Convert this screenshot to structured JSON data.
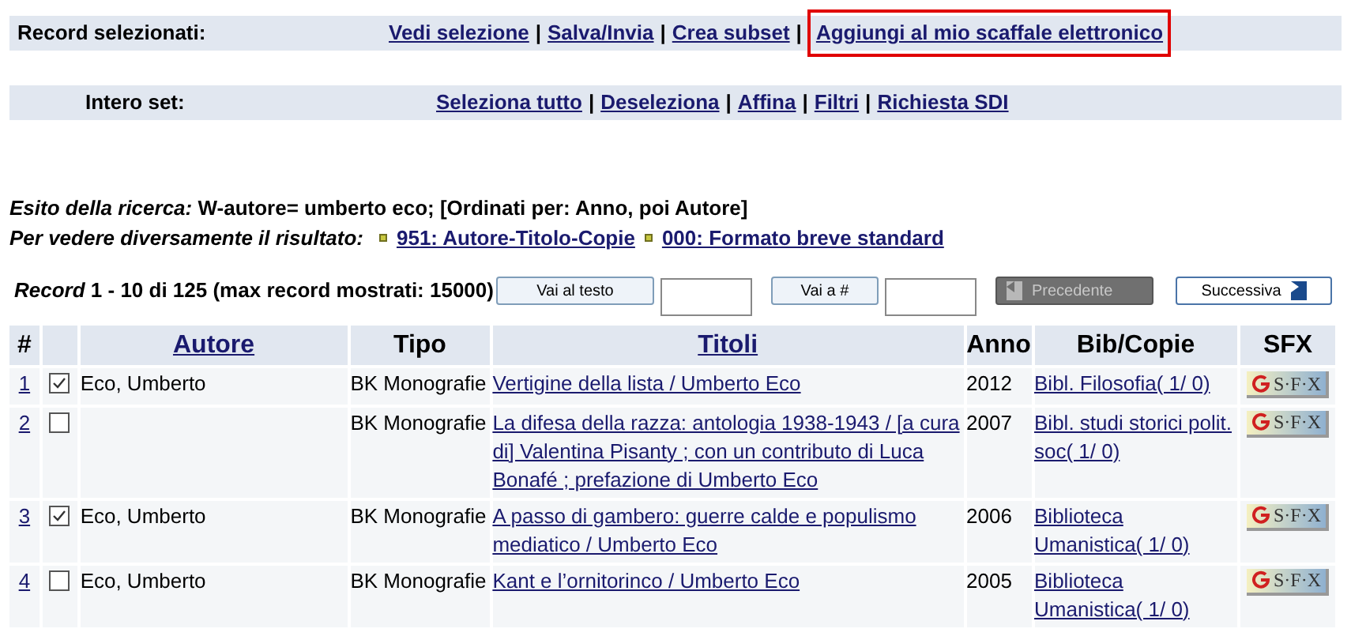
{
  "action_bars": [
    {
      "label": "Record selezionati:",
      "separator": "|",
      "links": [
        {
          "text": "Vedi selezione",
          "highlighted": false
        },
        {
          "text": "Salva/Invia",
          "highlighted": false
        },
        {
          "text": "Crea subset",
          "highlighted": false
        },
        {
          "text": "Aggiungi al mio scaffale elettronico",
          "highlighted": true
        }
      ]
    },
    {
      "label": "Intero set:",
      "separator": "|",
      "links": [
        {
          "text": "Seleziona tutto",
          "highlighted": false
        },
        {
          "text": "Deseleziona",
          "highlighted": false
        },
        {
          "text": "Affina",
          "highlighted": false
        },
        {
          "text": "Filtri",
          "highlighted": false
        },
        {
          "text": "Richiesta SDI",
          "highlighted": false
        }
      ]
    }
  ],
  "search_result": {
    "label": "Esito della ricerca:",
    "text": "W-autore= umberto eco; [Ordinati per: Anno, poi Autore]"
  },
  "view_formats": {
    "label": "Per vedere diversamente il risultato:",
    "links": [
      "951: Autore-Titolo-Copie",
      "000: Formato breve standard"
    ]
  },
  "record_range": "*Record* 1 - 10 di 125 (max record mostrati: 15000)",
  "jump_buttons": [
    "Vai al testo",
    "Vai a #"
  ],
  "pagination": [
    {
      "label": "Precedente",
      "disabled": true
    },
    {
      "label": "Successiva",
      "disabled": false
    }
  ],
  "table": {
    "columns": [
      {
        "label": "#",
        "kind": "text"
      },
      {
        "kind": "blank"
      },
      {
        "label": "Autore",
        "kind": "link"
      },
      {
        "label": "Tipo",
        "kind": "text"
      },
      {
        "label": "Titoli",
        "kind": "link"
      },
      {
        "label": "Anno",
        "kind": "text"
      },
      {
        "label": "Bib/Copie",
        "kind": "text"
      },
      {
        "label": "SFX",
        "kind": "text"
      }
    ],
    "rows": [
      {
        "number": "1",
        "checked": true,
        "author": "Eco, Umberto",
        "type": "BK Monografie",
        "title": "Vertigine della lista / Umberto Eco",
        "year": "2012",
        "holdings": "Bibl. Filosofia( 1/ 0)",
        "sfx": "S·F·X"
      },
      {
        "number": "2",
        "checked": false,
        "type": "BK Monografie",
        "title": "La difesa della razza: antologia 1938-1943 / [a cura di] Valentina Pisanty ; con un contributo di Luca Bonafé ; prefazione di Umberto Eco",
        "year": "2007",
        "holdings": "Bibl. studi storici polit. soc( 1/ 0)",
        "sfx": "S·F·X"
      },
      {
        "number": "3",
        "checked": true,
        "author": "Eco, Umberto",
        "type": "BK Monografie",
        "title": "A passo di gambero: guerre calde e populismo mediatico / Umberto Eco",
        "year": "2006",
        "holdings": "Biblioteca Umanistica( 1/ 0)",
        "sfx": "S·F·X"
      },
      {
        "number": "4",
        "checked": false,
        "author": "Eco, Umberto",
        "type": "BK Monografie",
        "title": "Kant e l’ornitorinco / Umberto Eco",
        "year": "2005",
        "holdings": "Biblioteca Umanistica( 1/ 0)",
        "sfx": "S·F·X"
      }
    ]
  }
}
